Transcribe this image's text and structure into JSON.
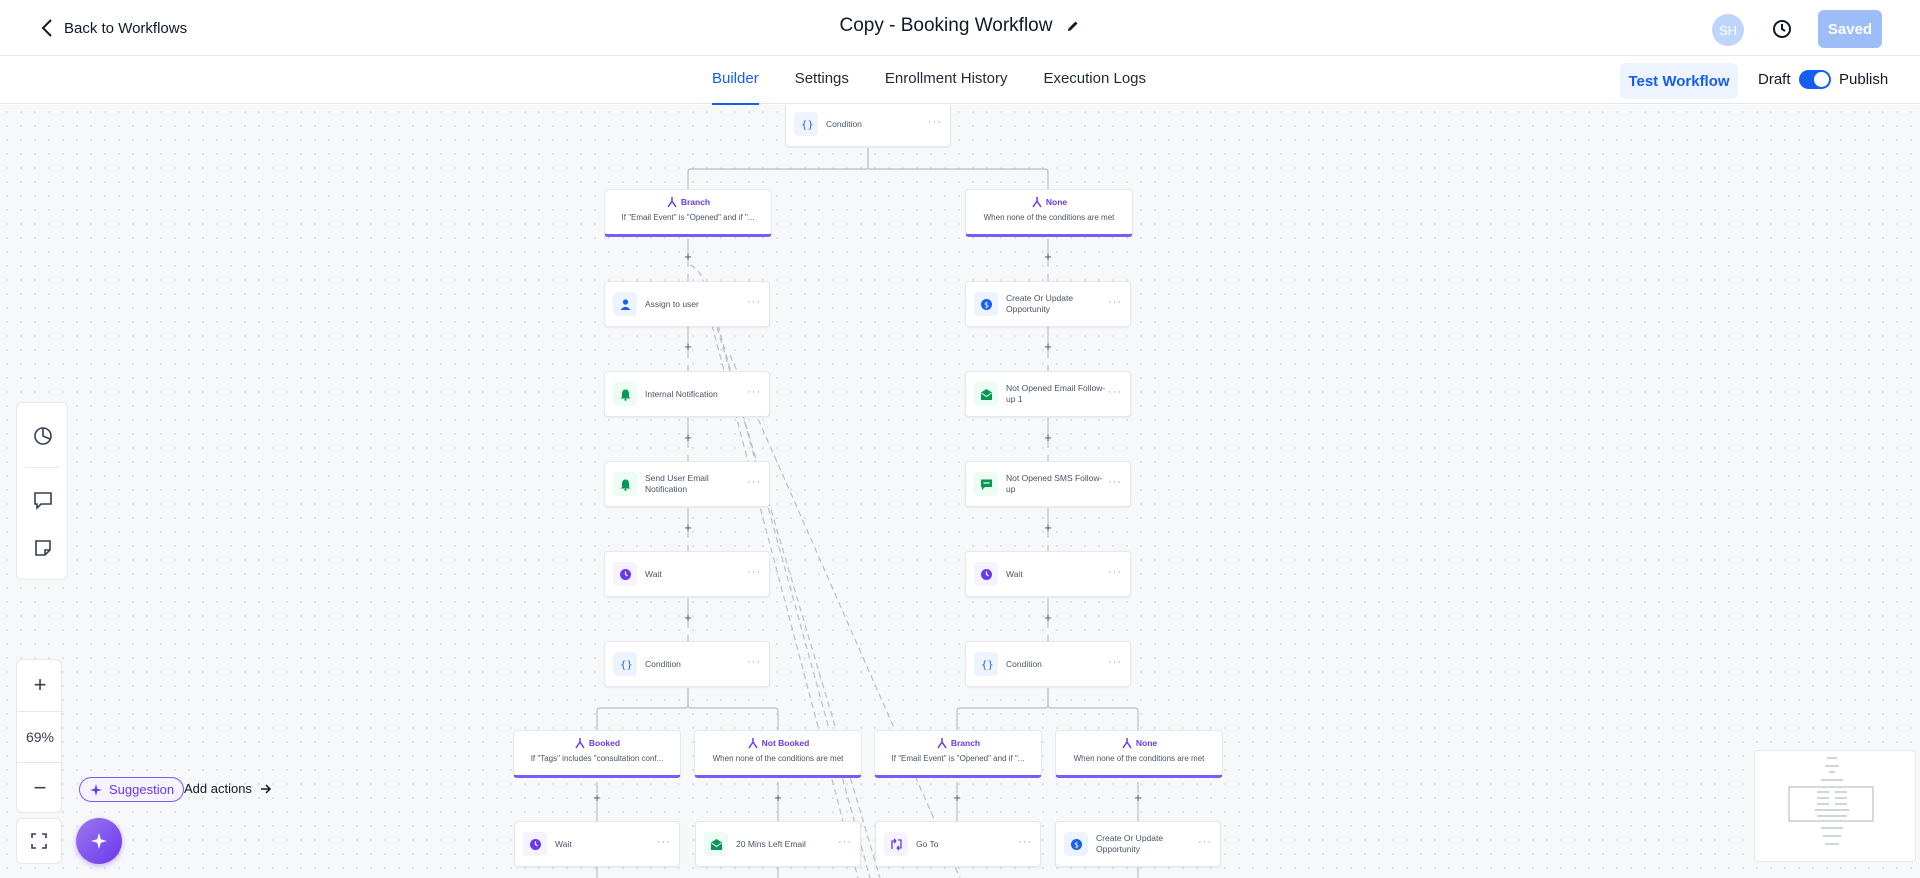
{
  "header": {
    "back_label": "Back to Workflows",
    "title": "Copy - Booking Workflow",
    "avatar_initials": "SH",
    "saved_label": "Saved"
  },
  "tabs": [
    {
      "label": "Builder",
      "active": true
    },
    {
      "label": "Settings",
      "active": false
    },
    {
      "label": "Enrollment History",
      "active": false
    },
    {
      "label": "Execution Logs",
      "active": false
    }
  ],
  "actions": {
    "test_workflow_label": "Test Workflow",
    "draft_label": "Draft",
    "publish_label": "Publish",
    "publish_toggle_on": true
  },
  "canvas": {
    "top_condition": "Condition",
    "branch_main": {
      "title": "Branch",
      "desc": "If \"Email Event\" is \"Opened\" and if \"..."
    },
    "none_main": {
      "title": "None",
      "desc": "When none of the conditions are met"
    },
    "left_column": [
      {
        "label": "Assign to user",
        "icon": "user-icon"
      },
      {
        "label": "Internal Notification",
        "icon": "bell-icon"
      },
      {
        "label": "Send User Email Notification",
        "icon": "bell-icon"
      },
      {
        "label": "Wait",
        "icon": "clock-icon"
      },
      {
        "label": "Condition",
        "icon": "braces-icon"
      }
    ],
    "right_column": [
      {
        "label": "Create Or Update Opportunity",
        "icon": "dollar-icon"
      },
      {
        "label": "Not Opened Email Follow-up 1",
        "icon": "mail-icon"
      },
      {
        "label": "Not Opened SMS Follow-up",
        "icon": "message-icon"
      },
      {
        "label": "Wait",
        "icon": "clock-icon"
      },
      {
        "label": "Condition",
        "icon": "braces-icon"
      }
    ],
    "lower_branches": [
      {
        "title": "Booked",
        "desc": "If \"Tags\" includes \"consultation conf..."
      },
      {
        "title": "Not Booked",
        "desc": "When none of the conditions are met"
      },
      {
        "title": "Branch",
        "desc": "If \"Email Event\" is \"Opened\" and if \"..."
      },
      {
        "title": "None",
        "desc": "When none of the conditions are met"
      }
    ],
    "bottom_row": [
      {
        "label": "Wait",
        "icon": "clock-icon"
      },
      {
        "label": "20 Mins Left Email",
        "icon": "mail-icon"
      },
      {
        "label": "Go To",
        "icon": "goto-icon"
      },
      {
        "label": "Create Or Update Opportunity",
        "icon": "dollar-icon"
      }
    ],
    "more_label": "···"
  },
  "zoom": {
    "level": "69%"
  },
  "suggestion": {
    "chip_label": "Suggestion",
    "add_actions_label": "Add actions"
  },
  "colors": {
    "primary": "#155eef",
    "branch_accent": "#7a5af8",
    "action_green": "#039855",
    "saved_disabled": "#9dbdf9"
  }
}
